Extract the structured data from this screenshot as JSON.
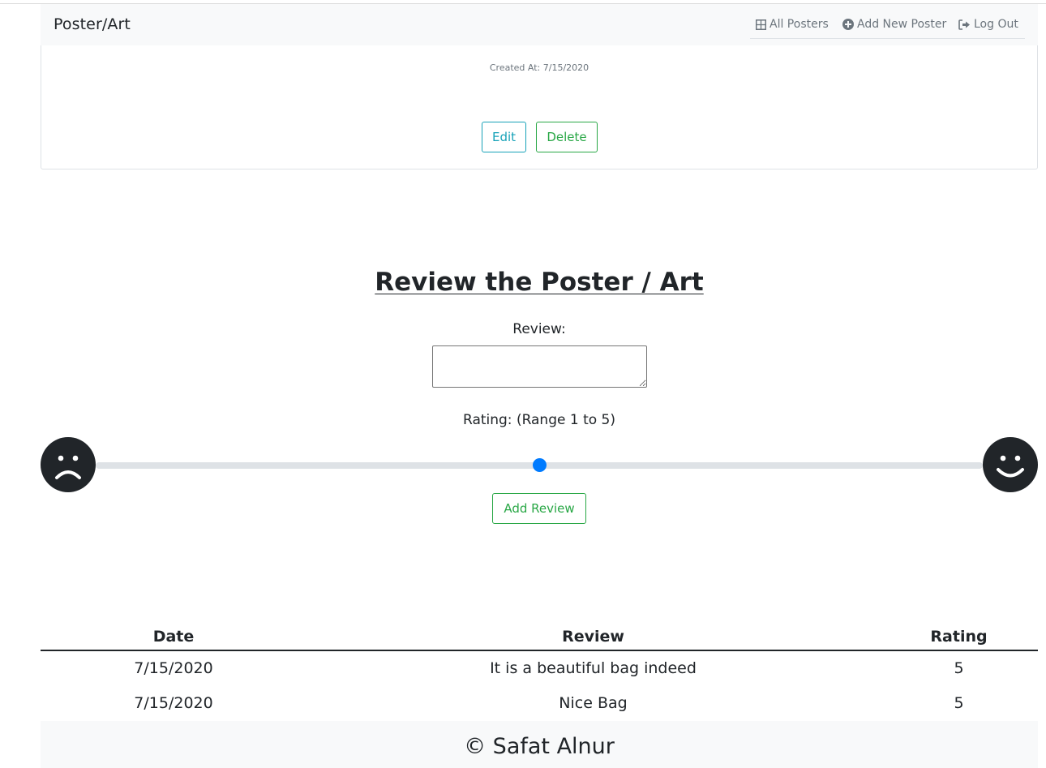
{
  "navbar": {
    "brand": "Poster/Art",
    "links": [
      {
        "label": "All Posters",
        "icon": "grid-icon"
      },
      {
        "label": "Add New Poster",
        "icon": "plus-circle-icon"
      },
      {
        "label": "Log Out",
        "icon": "sign-out-icon"
      }
    ]
  },
  "poster_card": {
    "created_at": "Created At: 7/15/2020",
    "edit_label": "Edit",
    "delete_label": "Delete"
  },
  "review_form": {
    "title": "Review the Poster / Art",
    "review_label": "Review:",
    "review_value": "",
    "rating_label": "Rating: (Range 1 to 5)",
    "rating_min": 1,
    "rating_max": 5,
    "rating_value": 3,
    "submit_label": "Add Review",
    "left_icon": "sad-face-icon",
    "right_icon": "happy-face-icon"
  },
  "reviews_table": {
    "headers": [
      "Date",
      "Review",
      "Rating"
    ],
    "rows": [
      [
        "7/15/2020",
        "It is a beautiful bag indeed",
        "5"
      ],
      [
        "7/15/2020",
        "Nice Bag",
        "5"
      ]
    ]
  },
  "footer": {
    "text": "© Safat Alnur"
  },
  "colors": {
    "accent_blue": "#007bff",
    "success_green": "#28a745",
    "info_teal": "#17a2b8",
    "navbar_bg": "#f8f9fa"
  }
}
